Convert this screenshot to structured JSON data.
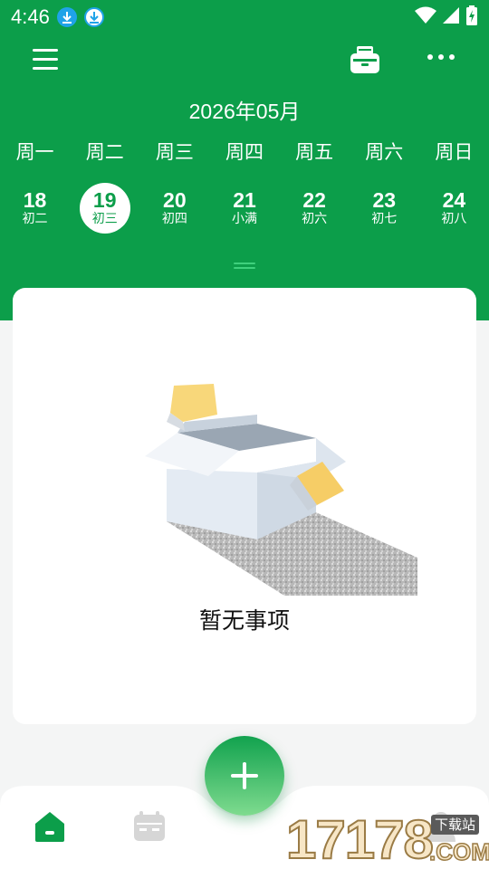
{
  "status_bar": {
    "time": "4:46",
    "icons": [
      "download-icon",
      "download-icon",
      "wifi-icon",
      "signal-icon",
      "battery-icon"
    ]
  },
  "app_bar": {
    "menu_icon": "menu-icon",
    "print_icon": "print-icon",
    "more_icon": "more-icon"
  },
  "calendar": {
    "month_title": "2026年05月",
    "weekdays": [
      "周一",
      "周二",
      "周三",
      "周四",
      "周五",
      "周六",
      "周日"
    ],
    "dates": [
      {
        "day": "18",
        "lunar": "初二",
        "selected": false
      },
      {
        "day": "19",
        "lunar": "初三",
        "selected": true
      },
      {
        "day": "20",
        "lunar": "初四",
        "selected": false
      },
      {
        "day": "21",
        "lunar": "小满",
        "selected": false
      },
      {
        "day": "22",
        "lunar": "初六",
        "selected": false
      },
      {
        "day": "23",
        "lunar": "初七",
        "selected": false
      },
      {
        "day": "24",
        "lunar": "初八",
        "selected": false
      }
    ]
  },
  "main": {
    "empty_text": "暂无事项"
  },
  "bottom_nav": {
    "items": [
      "home-icon",
      "calendar-icon",
      "profile-icon"
    ],
    "fab_icon": "plus-icon"
  },
  "watermark": {
    "number": "17178",
    "tag": "下载站",
    "domain": ".COM"
  },
  "colors": {
    "primary": "#0c9e4a",
    "background": "#f4f5f5",
    "card": "#ffffff"
  }
}
